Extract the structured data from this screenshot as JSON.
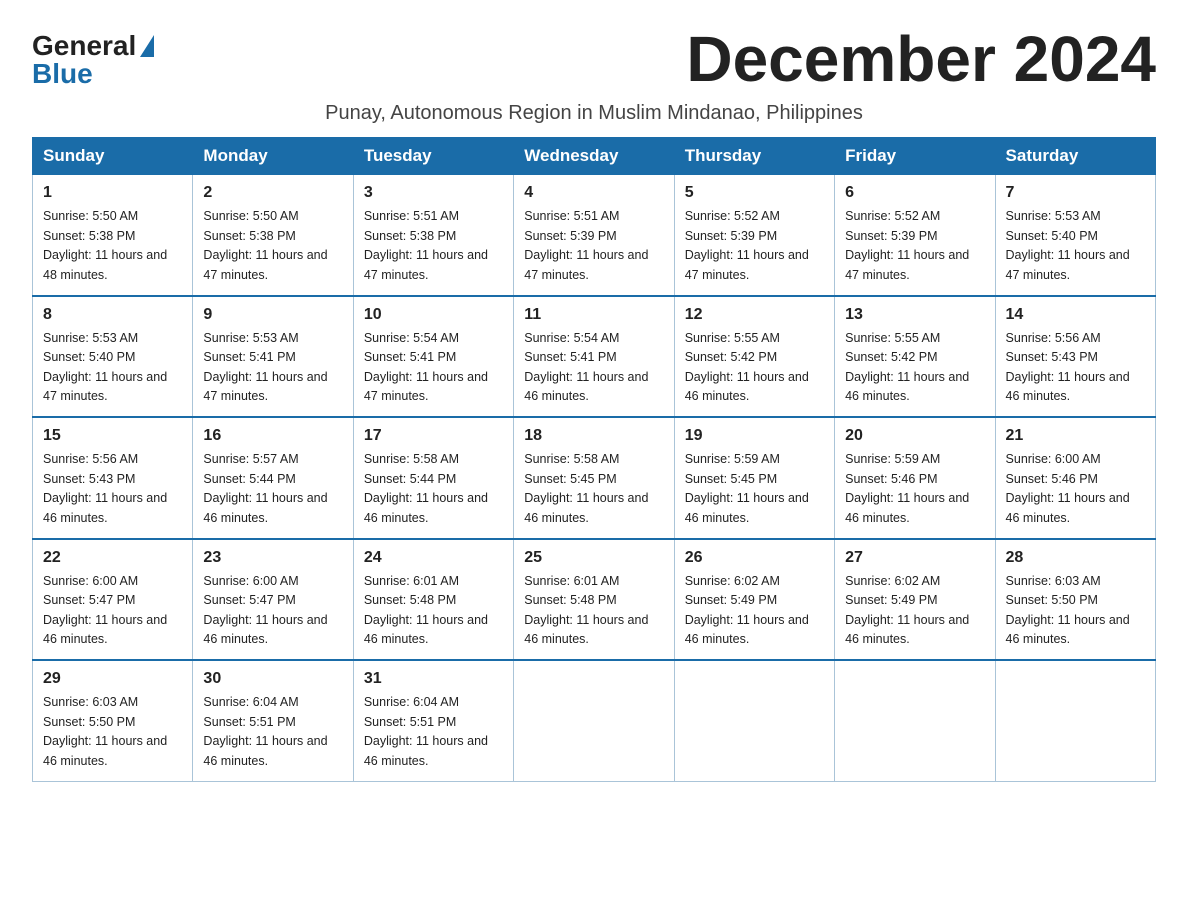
{
  "logo": {
    "general": "General",
    "blue": "Blue"
  },
  "title": "December 2024",
  "subtitle": "Punay, Autonomous Region in Muslim Mindanao, Philippines",
  "days_header": [
    "Sunday",
    "Monday",
    "Tuesday",
    "Wednesday",
    "Thursday",
    "Friday",
    "Saturday"
  ],
  "weeks": [
    [
      {
        "day": "1",
        "sunrise": "5:50 AM",
        "sunset": "5:38 PM",
        "daylight": "11 hours and 48 minutes."
      },
      {
        "day": "2",
        "sunrise": "5:50 AM",
        "sunset": "5:38 PM",
        "daylight": "11 hours and 47 minutes."
      },
      {
        "day": "3",
        "sunrise": "5:51 AM",
        "sunset": "5:38 PM",
        "daylight": "11 hours and 47 minutes."
      },
      {
        "day": "4",
        "sunrise": "5:51 AM",
        "sunset": "5:39 PM",
        "daylight": "11 hours and 47 minutes."
      },
      {
        "day": "5",
        "sunrise": "5:52 AM",
        "sunset": "5:39 PM",
        "daylight": "11 hours and 47 minutes."
      },
      {
        "day": "6",
        "sunrise": "5:52 AM",
        "sunset": "5:39 PM",
        "daylight": "11 hours and 47 minutes."
      },
      {
        "day": "7",
        "sunrise": "5:53 AM",
        "sunset": "5:40 PM",
        "daylight": "11 hours and 47 minutes."
      }
    ],
    [
      {
        "day": "8",
        "sunrise": "5:53 AM",
        "sunset": "5:40 PM",
        "daylight": "11 hours and 47 minutes."
      },
      {
        "day": "9",
        "sunrise": "5:53 AM",
        "sunset": "5:41 PM",
        "daylight": "11 hours and 47 minutes."
      },
      {
        "day": "10",
        "sunrise": "5:54 AM",
        "sunset": "5:41 PM",
        "daylight": "11 hours and 47 minutes."
      },
      {
        "day": "11",
        "sunrise": "5:54 AM",
        "sunset": "5:41 PM",
        "daylight": "11 hours and 46 minutes."
      },
      {
        "day": "12",
        "sunrise": "5:55 AM",
        "sunset": "5:42 PM",
        "daylight": "11 hours and 46 minutes."
      },
      {
        "day": "13",
        "sunrise": "5:55 AM",
        "sunset": "5:42 PM",
        "daylight": "11 hours and 46 minutes."
      },
      {
        "day": "14",
        "sunrise": "5:56 AM",
        "sunset": "5:43 PM",
        "daylight": "11 hours and 46 minutes."
      }
    ],
    [
      {
        "day": "15",
        "sunrise": "5:56 AM",
        "sunset": "5:43 PM",
        "daylight": "11 hours and 46 minutes."
      },
      {
        "day": "16",
        "sunrise": "5:57 AM",
        "sunset": "5:44 PM",
        "daylight": "11 hours and 46 minutes."
      },
      {
        "day": "17",
        "sunrise": "5:58 AM",
        "sunset": "5:44 PM",
        "daylight": "11 hours and 46 minutes."
      },
      {
        "day": "18",
        "sunrise": "5:58 AM",
        "sunset": "5:45 PM",
        "daylight": "11 hours and 46 minutes."
      },
      {
        "day": "19",
        "sunrise": "5:59 AM",
        "sunset": "5:45 PM",
        "daylight": "11 hours and 46 minutes."
      },
      {
        "day": "20",
        "sunrise": "5:59 AM",
        "sunset": "5:46 PM",
        "daylight": "11 hours and 46 minutes."
      },
      {
        "day": "21",
        "sunrise": "6:00 AM",
        "sunset": "5:46 PM",
        "daylight": "11 hours and 46 minutes."
      }
    ],
    [
      {
        "day": "22",
        "sunrise": "6:00 AM",
        "sunset": "5:47 PM",
        "daylight": "11 hours and 46 minutes."
      },
      {
        "day": "23",
        "sunrise": "6:00 AM",
        "sunset": "5:47 PM",
        "daylight": "11 hours and 46 minutes."
      },
      {
        "day": "24",
        "sunrise": "6:01 AM",
        "sunset": "5:48 PM",
        "daylight": "11 hours and 46 minutes."
      },
      {
        "day": "25",
        "sunrise": "6:01 AM",
        "sunset": "5:48 PM",
        "daylight": "11 hours and 46 minutes."
      },
      {
        "day": "26",
        "sunrise": "6:02 AM",
        "sunset": "5:49 PM",
        "daylight": "11 hours and 46 minutes."
      },
      {
        "day": "27",
        "sunrise": "6:02 AM",
        "sunset": "5:49 PM",
        "daylight": "11 hours and 46 minutes."
      },
      {
        "day": "28",
        "sunrise": "6:03 AM",
        "sunset": "5:50 PM",
        "daylight": "11 hours and 46 minutes."
      }
    ],
    [
      {
        "day": "29",
        "sunrise": "6:03 AM",
        "sunset": "5:50 PM",
        "daylight": "11 hours and 46 minutes."
      },
      {
        "day": "30",
        "sunrise": "6:04 AM",
        "sunset": "5:51 PM",
        "daylight": "11 hours and 46 minutes."
      },
      {
        "day": "31",
        "sunrise": "6:04 AM",
        "sunset": "5:51 PM",
        "daylight": "11 hours and 46 minutes."
      },
      null,
      null,
      null,
      null
    ]
  ]
}
